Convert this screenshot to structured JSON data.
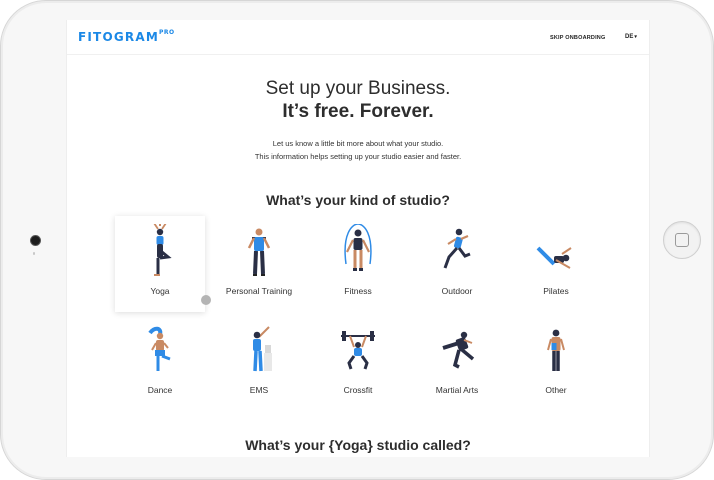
{
  "header": {
    "logo_main": "FITOGRAM",
    "logo_sup": "PRO",
    "skip_label": "SKIP ONBOARDING",
    "language": "DE",
    "language_icon": "chevron-down-icon"
  },
  "hero": {
    "title_line1": "Set up your Business.",
    "title_line2": "It’s free. Forever."
  },
  "intro": {
    "line1": "Let us know a little bit more about what your studio.",
    "line2": "This information helps setting up your studio easier and faster."
  },
  "studio_kinds": {
    "heading": "What’s your kind of studio?",
    "selected": "Yoga",
    "items": [
      {
        "label": "Yoga",
        "icon": "yoga-figure-icon"
      },
      {
        "label": "Personal Training",
        "icon": "personal-trainer-icon"
      },
      {
        "label": "Fitness",
        "icon": "jump-rope-icon"
      },
      {
        "label": "Outdoor",
        "icon": "runner-icon"
      },
      {
        "label": "Pilates",
        "icon": "pilates-icon"
      },
      {
        "label": "Dance",
        "icon": "dancer-icon"
      },
      {
        "label": "EMS",
        "icon": "ems-figure-icon"
      },
      {
        "label": "Crossfit",
        "icon": "weightlifter-icon"
      },
      {
        "label": "Martial Arts",
        "icon": "martial-arts-kick-icon"
      },
      {
        "label": "Other",
        "icon": "athlete-icon"
      }
    ]
  },
  "studio_name": {
    "heading": "What’s your {Yoga} studio called?"
  },
  "colors": {
    "brand_blue": "#1b88e6",
    "figure_dark": "#2a2f45",
    "skin": "#c98a63"
  }
}
